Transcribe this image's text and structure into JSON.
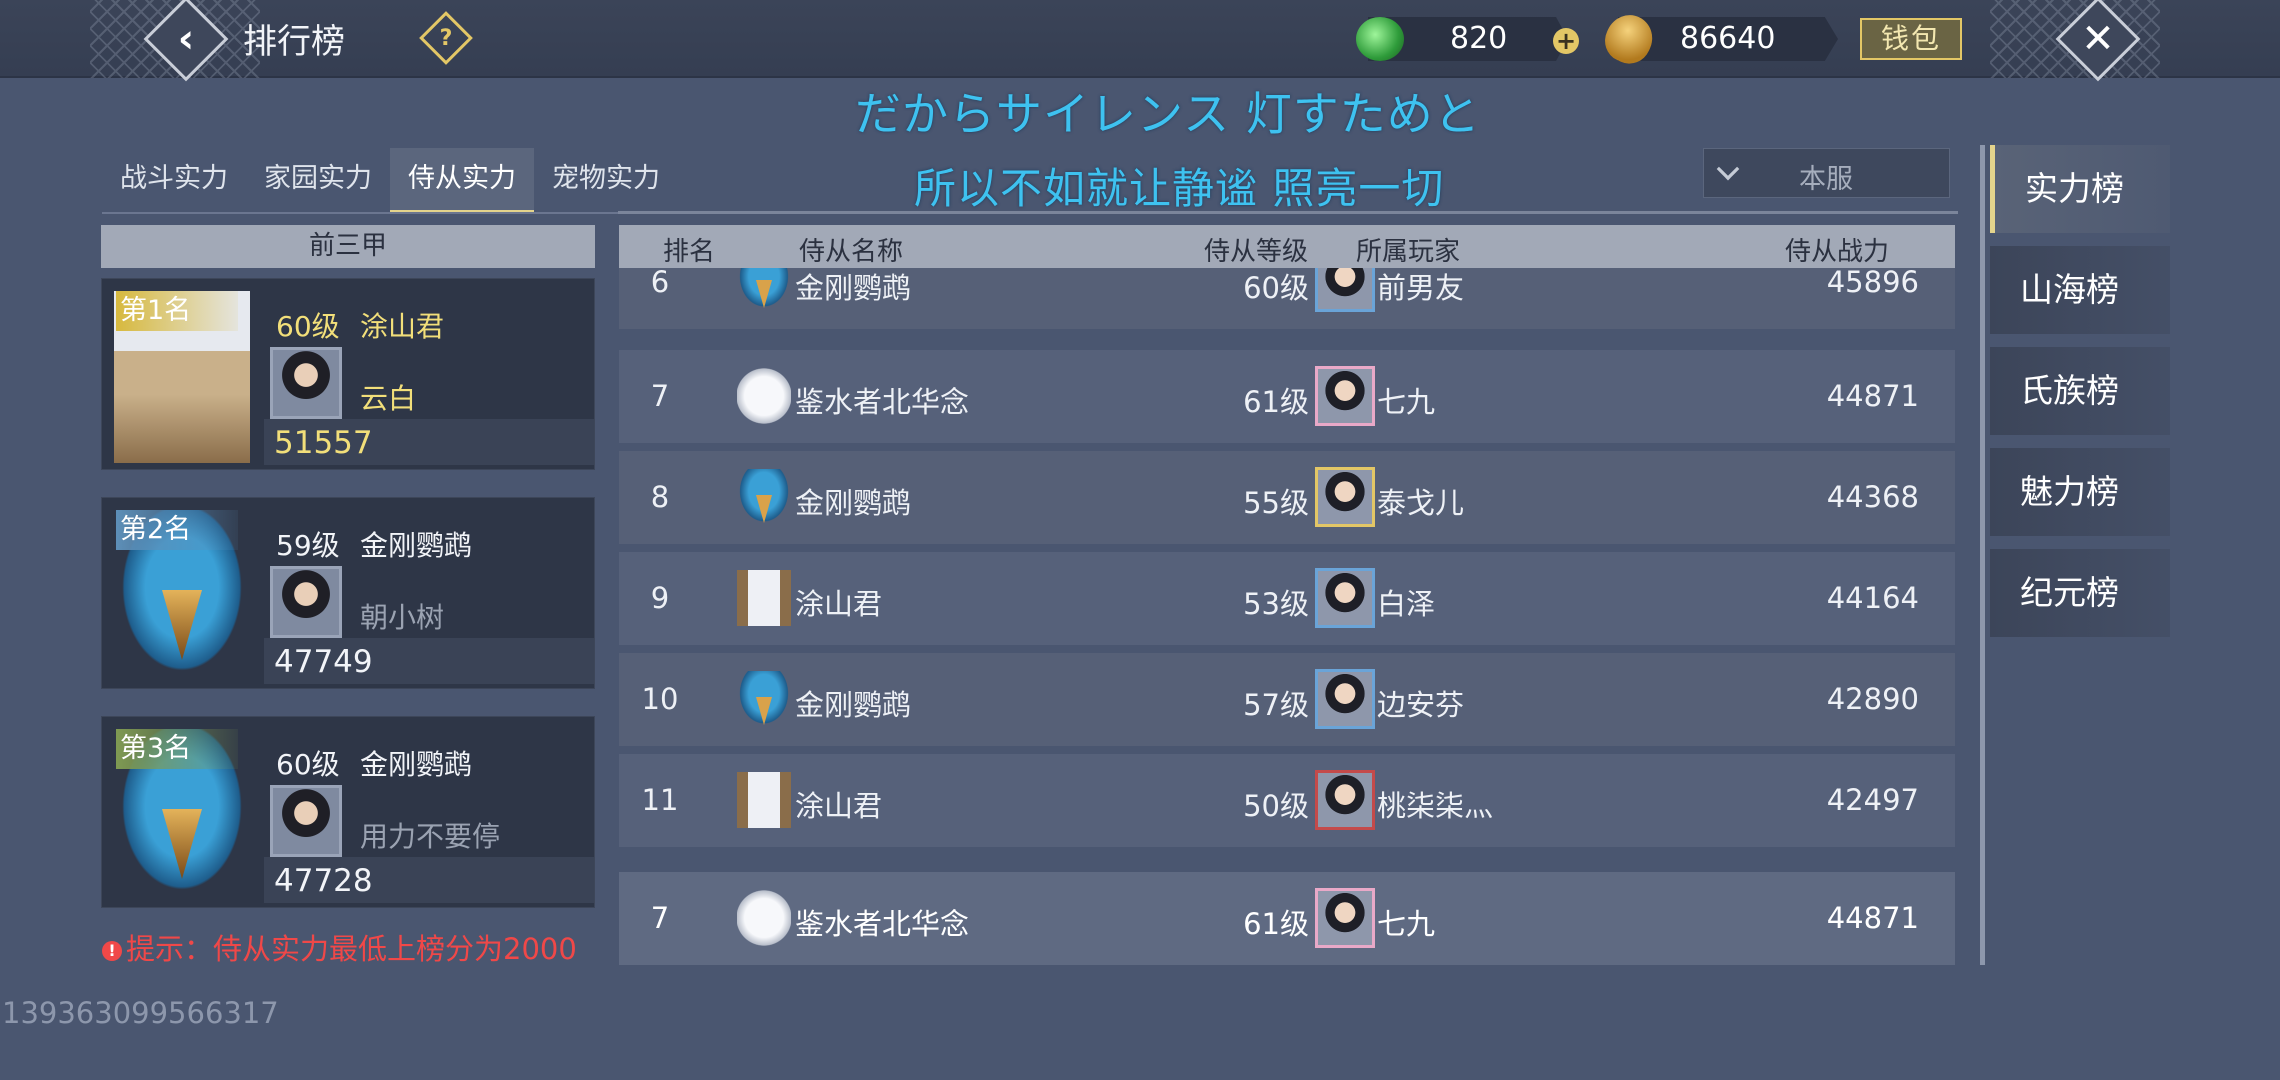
{
  "header": {
    "title": "排行榜",
    "help_icon": "question-icon",
    "currencies": [
      {
        "icon": "jade-icon",
        "value": "820"
      },
      {
        "icon": "seed-icon",
        "value": "86640"
      }
    ],
    "wallet_label": "钱包"
  },
  "lyrics": {
    "line1": "だからサイレンス 灯すためと",
    "line2": "所以不如就让静谧 照亮一切"
  },
  "tabs": [
    {
      "label": "战斗实力",
      "active": false
    },
    {
      "label": "家园实力",
      "active": false
    },
    {
      "label": "侍从实力",
      "active": true
    },
    {
      "label": "宠物实力",
      "active": false
    }
  ],
  "server_select": {
    "value": "本服"
  },
  "top3": {
    "header": "前三甲",
    "cards": [
      {
        "rank_label": "第1名",
        "level": "60级",
        "companion": "涂山君",
        "player": "云白",
        "power": "51557"
      },
      {
        "rank_label": "第2名",
        "level": "59级",
        "companion": "金刚鹦鹉",
        "player": "朝小树",
        "power": "47749"
      },
      {
        "rank_label": "第3名",
        "level": "60级",
        "companion": "金刚鹦鹉",
        "player": "用力不要停",
        "power": "47728"
      }
    ]
  },
  "tip": "提示：侍从实力最低上榜分为2000",
  "watermark": "139363099566317",
  "list": {
    "columns": {
      "rank": "排名",
      "companion": "侍从名称",
      "level": "侍从等级",
      "player": "所属玩家",
      "power": "侍从战力"
    },
    "rows": [
      {
        "rank": "6",
        "companion": "金刚鹦鹉",
        "level": "60级",
        "player": "前男友",
        "power": "45896"
      },
      {
        "rank": "7",
        "companion": "鉴水者北华念",
        "level": "61级",
        "player": "七九",
        "power": "44871"
      },
      {
        "rank": "8",
        "companion": "金刚鹦鹉",
        "level": "55级",
        "player": "泰戈儿",
        "power": "44368"
      },
      {
        "rank": "9",
        "companion": "涂山君",
        "level": "53级",
        "player": "白泽",
        "power": "44164"
      },
      {
        "rank": "10",
        "companion": "金刚鹦鹉",
        "level": "57级",
        "player": "边安芬",
        "power": "42890"
      },
      {
        "rank": "11",
        "companion": "涂山君",
        "level": "50级",
        "player": "桃柒柒灬",
        "power": "42497"
      }
    ],
    "my_row": {
      "rank": "7",
      "companion": "鉴水者北华念",
      "level": "61级",
      "player": "七九",
      "power": "44871"
    }
  },
  "side_tabs": [
    {
      "label": "实力榜",
      "active": true
    },
    {
      "label": "山海榜",
      "active": false
    },
    {
      "label": "氏族榜",
      "active": false
    },
    {
      "label": "魅力榜",
      "active": false
    },
    {
      "label": "纪元榜",
      "active": false
    }
  ]
}
